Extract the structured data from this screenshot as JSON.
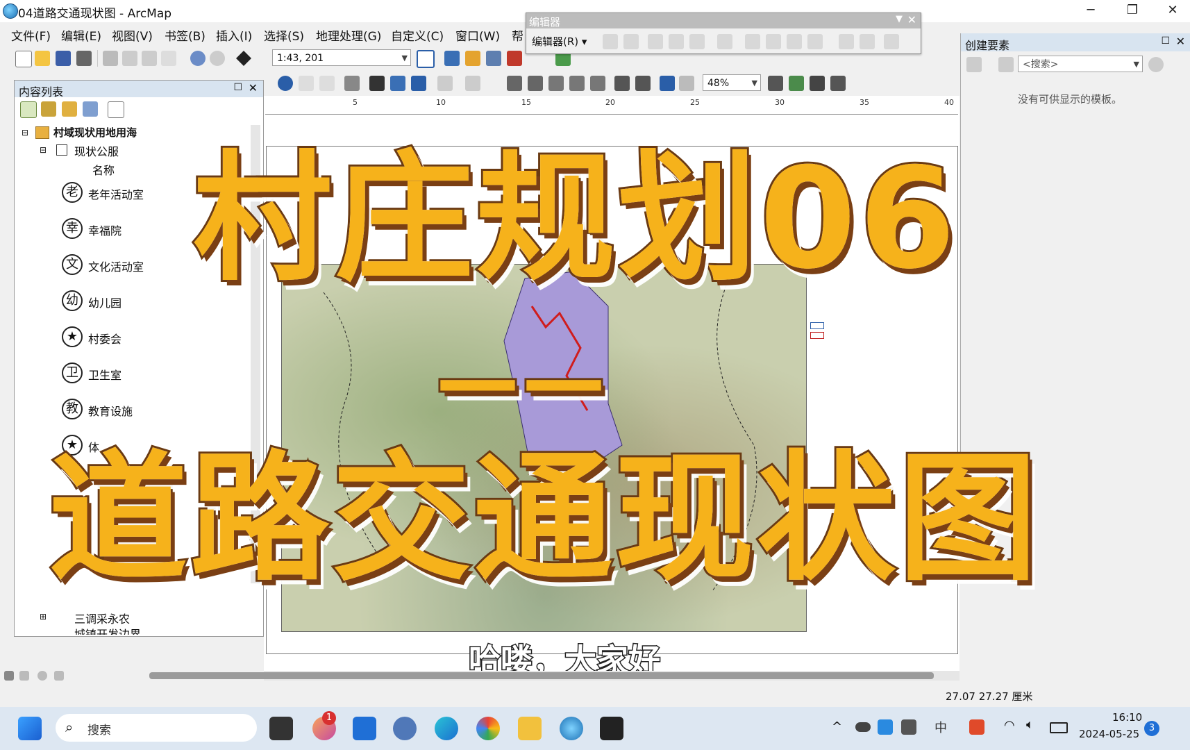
{
  "window": {
    "title": "04道路交通现状图 - ArcMap",
    "controls": [
      "─",
      "❐",
      "✕"
    ]
  },
  "menu": [
    "文件(F)",
    "编辑(E)",
    "视图(V)",
    "书签(B)",
    "插入(I)",
    "选择(S)",
    "地理处理(G)",
    "自定义(C)",
    "窗口(W)",
    "帮"
  ],
  "toolbar": {
    "scale_value": "1:43, 201",
    "zoom_value": "48%"
  },
  "editor": {
    "title": "编辑器",
    "menu_label": "编辑器(R) ▾"
  },
  "toc": {
    "title": "内容列表",
    "group": "村域现状用地用海",
    "layer": "现状公服",
    "field": "名称",
    "items": [
      {
        "symbol": "老",
        "label": "老年活动室"
      },
      {
        "symbol": "幸",
        "label": "幸福院"
      },
      {
        "symbol": "文",
        "label": "文化活动室"
      },
      {
        "symbol": "幼",
        "label": "幼儿园"
      },
      {
        "symbol": "★",
        "label": "村委会"
      },
      {
        "symbol": "卫",
        "label": "卫生室"
      },
      {
        "symbol": "教",
        "label": "教育设施"
      },
      {
        "symbol": "★",
        "label": "体"
      }
    ],
    "bottom_layers": [
      "三调采永农",
      "城镇开发边界"
    ]
  },
  "ruler": {
    "ticks": [
      "5",
      "10",
      "15",
      "20",
      "25",
      "30",
      "35",
      "40"
    ]
  },
  "create_features": {
    "title": "创建要素",
    "search_placeholder": "<搜索>",
    "empty_message": "没有可供显示的模板。"
  },
  "overlay": {
    "line1": "村庄规划06",
    "dash": "——",
    "line2": "道路交通现状图",
    "subtitle": "哈喽，大家好"
  },
  "status": {
    "coords": "27.07  27.27 厘米"
  },
  "taskbar": {
    "search_label": "搜索",
    "badge_count": "1",
    "time": "16:10",
    "date": "2024-05-25",
    "notification_count": "3"
  }
}
